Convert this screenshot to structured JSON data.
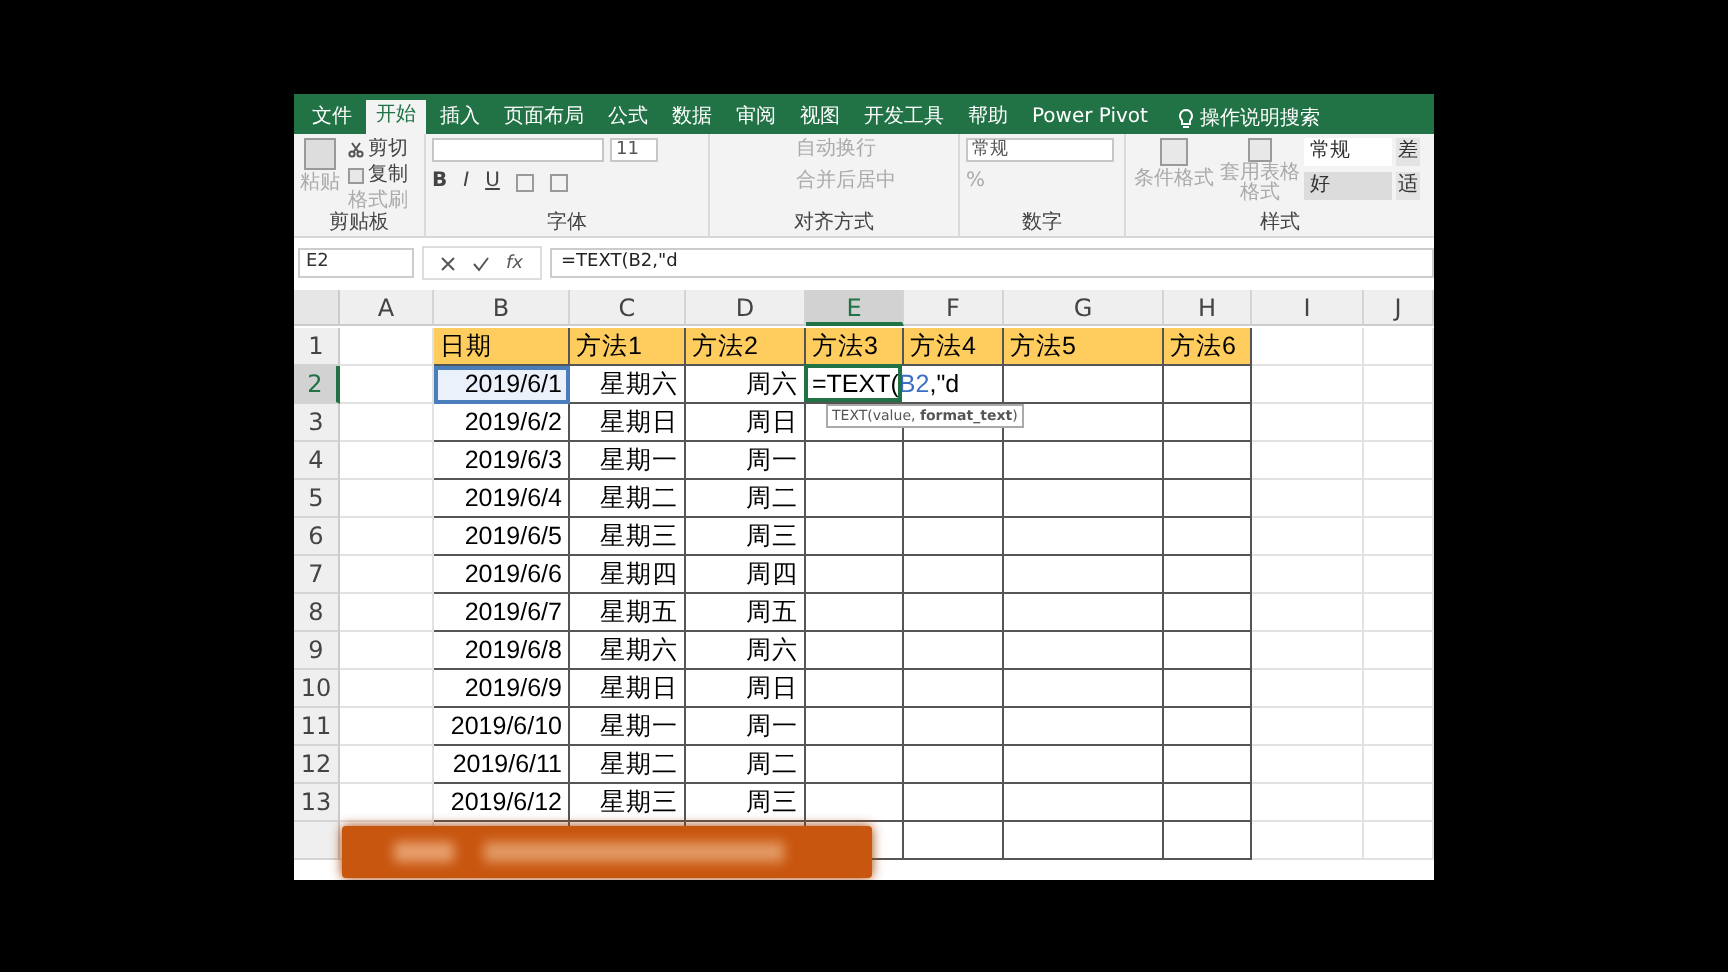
{
  "tabs": [
    {
      "label": "文件",
      "selected": false
    },
    {
      "label": "开始",
      "selected": true
    },
    {
      "label": "插入",
      "selected": false
    },
    {
      "label": "页面布局",
      "selected": false
    },
    {
      "label": "公式",
      "selected": false
    },
    {
      "label": "数据",
      "selected": false
    },
    {
      "label": "审阅",
      "selected": false
    },
    {
      "label": "视图",
      "selected": false
    },
    {
      "label": "开发工具",
      "selected": false
    },
    {
      "label": "帮助",
      "selected": false
    },
    {
      "label": "Power Pivot",
      "selected": false
    }
  ],
  "tell_me": {
    "placeholder": "操作说明搜索"
  },
  "ribbon": {
    "clipboard": {
      "paste": "粘贴",
      "cut": "剪切",
      "copy": "复制",
      "format_painter": "格式刷",
      "label": "剪贴板"
    },
    "font": {
      "size": "11",
      "bold": "B",
      "italic": "I",
      "underline": "U",
      "label": "字体"
    },
    "alignment": {
      "wrap": "自动换行",
      "merge": "合并后居中",
      "label": "对齐方式"
    },
    "number": {
      "format": "常规",
      "percent": "%",
      "label": "数字"
    },
    "styles": {
      "conditional": "条件格式",
      "table_format": "套用表格格式",
      "cells": [
        "常规",
        "好"
      ],
      "cut_cells": [
        "差",
        "适"
      ],
      "label": "样式"
    }
  },
  "formula_bar": {
    "name_box": "E2",
    "fx": "fx",
    "formula": "=TEXT(B2,\"d"
  },
  "sheet": {
    "columns": [
      {
        "letter": "A",
        "selected": false
      },
      {
        "letter": "B",
        "selected": false
      },
      {
        "letter": "C",
        "selected": false
      },
      {
        "letter": "D",
        "selected": false
      },
      {
        "letter": "E",
        "selected": true
      },
      {
        "letter": "F",
        "selected": false
      },
      {
        "letter": "G",
        "selected": false
      },
      {
        "letter": "H",
        "selected": false
      },
      {
        "letter": "I",
        "selected": false
      },
      {
        "letter": "J",
        "selected": false
      }
    ],
    "rows": [
      {
        "number": "1",
        "selected": false,
        "kind": "header",
        "cells": [
          {},
          {
            "text": "日期"
          },
          {
            "text": "方法1"
          },
          {
            "text": "方法2"
          },
          {
            "text": "方法3"
          },
          {
            "text": "方法4"
          },
          {
            "text": "方法5"
          },
          {
            "text": "方法6"
          },
          {},
          {}
        ]
      },
      {
        "number": "2",
        "selected": true,
        "kind": "data",
        "cells": [
          {},
          {
            "text": "2019/6/1",
            "referenced": true
          },
          {
            "text": "星期六"
          },
          {
            "text": "周六"
          },
          {
            "kind": "editing",
            "before": "=TEXT(",
            "ref": "B2",
            "after": ",\"d",
            "hint": "TEXT(value, **format_text**)"
          },
          {},
          {},
          {},
          {},
          {}
        ]
      },
      {
        "number": "3",
        "selected": false,
        "kind": "data",
        "cells": [
          {},
          {
            "text": "2019/6/2"
          },
          {
            "text": "星期日"
          },
          {
            "text": "周日"
          },
          {},
          {},
          {},
          {},
          {},
          {}
        ]
      },
      {
        "number": "4",
        "selected": false,
        "kind": "data",
        "cells": [
          {},
          {
            "text": "2019/6/3"
          },
          {
            "text": "星期一"
          },
          {
            "text": "周一"
          },
          {},
          {},
          {},
          {},
          {},
          {}
        ]
      },
      {
        "number": "5",
        "selected": false,
        "kind": "data",
        "cells": [
          {},
          {
            "text": "2019/6/4"
          },
          {
            "text": "星期二"
          },
          {
            "text": "周二"
          },
          {},
          {},
          {},
          {},
          {},
          {}
        ]
      },
      {
        "number": "6",
        "selected": false,
        "kind": "data",
        "cells": [
          {},
          {
            "text": "2019/6/5"
          },
          {
            "text": "星期三"
          },
          {
            "text": "周三"
          },
          {},
          {},
          {},
          {},
          {},
          {}
        ]
      },
      {
        "number": "7",
        "selected": false,
        "kind": "data",
        "cells": [
          {},
          {
            "text": "2019/6/6"
          },
          {
            "text": "星期四"
          },
          {
            "text": "周四"
          },
          {},
          {},
          {},
          {},
          {},
          {}
        ]
      },
      {
        "number": "8",
        "selected": false,
        "kind": "data",
        "cells": [
          {},
          {
            "text": "2019/6/7"
          },
          {
            "text": "星期五"
          },
          {
            "text": "周五"
          },
          {},
          {},
          {},
          {},
          {},
          {}
        ]
      },
      {
        "number": "9",
        "selected": false,
        "kind": "data",
        "cells": [
          {},
          {
            "text": "2019/6/8"
          },
          {
            "text": "星期六"
          },
          {
            "text": "周六"
          },
          {},
          {},
          {},
          {},
          {},
          {}
        ]
      },
      {
        "number": "10",
        "selected": false,
        "kind": "data",
        "cells": [
          {},
          {
            "text": "2019/6/9"
          },
          {
            "text": "星期日"
          },
          {
            "text": "周日"
          },
          {},
          {},
          {},
          {},
          {},
          {}
        ]
      },
      {
        "number": "11",
        "selected": false,
        "kind": "data",
        "cells": [
          {},
          {
            "text": "2019/6/10"
          },
          {
            "text": "星期一"
          },
          {
            "text": "周一"
          },
          {},
          {},
          {},
          {},
          {},
          {}
        ]
      },
      {
        "number": "12",
        "selected": false,
        "kind": "data",
        "cells": [
          {},
          {
            "text": "2019/6/11"
          },
          {
            "text": "星期二"
          },
          {
            "text": "周二"
          },
          {},
          {},
          {},
          {},
          {},
          {}
        ]
      },
      {
        "number": "13",
        "selected": false,
        "kind": "data",
        "cells": [
          {},
          {
            "text": "2019/6/12"
          },
          {
            "text": "星期三"
          },
          {
            "text": "周三"
          },
          {},
          {},
          {},
          {},
          {},
          {}
        ]
      },
      {
        "selected": false,
        "kind": "data",
        "cells": [
          {},
          {},
          {},
          {},
          {},
          {},
          {},
          {},
          {},
          {}
        ]
      }
    ]
  }
}
